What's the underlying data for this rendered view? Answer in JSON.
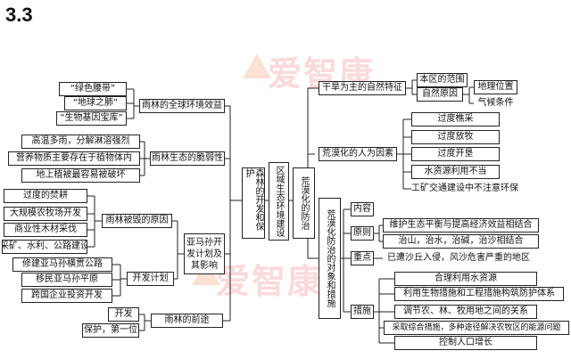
{
  "heading": "3.3",
  "watermark": "爱智康",
  "center": {
    "n1": "森林的开发和保护",
    "n2": "区域生态环境建设",
    "n3": "荒漠化的防治"
  },
  "left": {
    "gl": {
      "label": "雨林的全球环境效益",
      "items": [
        "“绿色腰带”",
        "“地球之肺”",
        "“生物基因宝库”"
      ]
    },
    "fr": {
      "label": "雨林生态的脆弱性",
      "items": [
        "高温多雨，分解淋溶强烈",
        "营养物质主要存在于植物体内",
        "地上植被最容易被破坏"
      ]
    },
    "am": {
      "label": "亚马孙开发计划及其影响",
      "dc": {
        "label": "雨林被毁的原因",
        "items": [
          "过度的焚耕",
          "大规模农牧场开发",
          "商业性木材采伐",
          "采矿、水利、公路建设"
        ]
      },
      "dp": {
        "label": "开发计划",
        "items": [
          "修建亚马孙横贯公路",
          "移民亚马孙平原",
          "跨国企业投资开发"
        ]
      }
    },
    "fu": {
      "label": "雨林的前途",
      "items": [
        "开发",
        "保护，第一位"
      ]
    }
  },
  "right": {
    "nf": {
      "label": "干旱为主的自然特征",
      "region": "本区的范围",
      "natural_cause": "自然原因",
      "geo": "地理位置",
      "climate": "气候条件"
    },
    "hf": {
      "label": "荒漠化的人为因素",
      "items": [
        "过度樵采",
        "过度放牧",
        "过度开垦",
        "水资源利用不当",
        "工矿交通建设中不注意环保"
      ]
    },
    "pm": {
      "label": "荒漠化防治的对象和措施",
      "content": "内容",
      "principle": {
        "label": "原则",
        "items": [
          "维护生态平衡与提高经济效益相结合",
          "治山，治水，治碱，治沙相结合"
        ]
      },
      "focus": {
        "label": "重点",
        "item": "已遭沙丘入侵，风沙危害严重的地区"
      },
      "measures": {
        "label": "措施",
        "items": [
          "合理利用水资源",
          "利用生物措施和工程措施构筑防护体系",
          "调节农、林、牧用地之间的关系",
          "采取综合措施，多种途径解决农牧区的能源问题",
          "控制人口增长"
        ]
      }
    }
  }
}
